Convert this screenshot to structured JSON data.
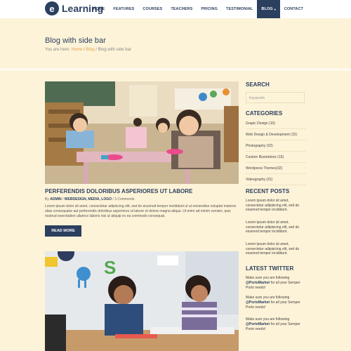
{
  "logo": {
    "letter": "e",
    "text": "Learning"
  },
  "nav": [
    "HOME",
    "FEATURES",
    "COURSES",
    "TEACHERS",
    "PRICING",
    "TESTIMONIAL",
    "BLOG",
    "CONTACT"
  ],
  "banner": {
    "title": "Blog with side bar",
    "crumb_prefix": "You are here:",
    "crumb_home": "Home",
    "crumb_blog": "Blog",
    "crumb_current": "Blog with side bar"
  },
  "post": {
    "title": "PERFERENDIS DOLORIBUS ASPERIORES UT LABORE",
    "meta_by": "By",
    "meta_author": "ADMIN",
    "meta_tags": "WEBDESIGN, MEDIA, LOGO",
    "meta_comments": "3 Comments",
    "excerpt": "Lorem ipsum dolor sit amet, consectetur adipiscing elit, sed do eiusmod tempor incididunt ut ut reiciendise voluptat maiores alias consequatur aut perferendis doloribus asperiores ut labore et dolore magna aliqua. Ut enim ad minim veniam, quis nostrud exercitation ullamco laboris nisi ut aliquip ex ea commodo consequat.",
    "button": "READ MORE"
  },
  "sidebar": {
    "search_title": "SEARCH",
    "search_placeholder": "Keywords",
    "categories_title": "CATEGORIES",
    "categories": [
      "Grapic Design (10)",
      "Web Design & Development (15)",
      "Photography (32)",
      "Custom Illustrations (16)",
      "Wordpress Themes(32)",
      "Videography (31)"
    ],
    "recent_title": "RECENT POSTS",
    "recent": [
      "Lorem ipsum dolor sit amet, consectetur adipisicing elit, sed do eiusmod tempor incididunt.",
      "Lorem ipsum dolor sit amet, consectetur adipisicing elit, sed do eiusmod tempor incididunt.",
      "Lorem ipsum dolor sit amet, consectetur adipisicing elit, sed do eiusmod tempor incididunt."
    ],
    "twitter_title": "LATEST TWITTER",
    "tweet_pre": "Make sure you are following",
    "tweet_handle": "@PortoMarket",
    "tweet_post": "for all your Semper Porto needs!"
  },
  "colors": {
    "navy": "#2b3f5f",
    "cream": "#fdf3d8",
    "accent": "#e8a04a"
  }
}
